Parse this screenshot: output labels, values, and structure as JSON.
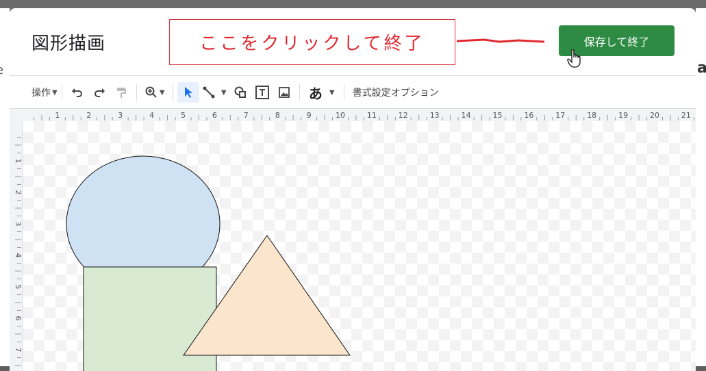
{
  "dialog": {
    "title": "図形描画",
    "save_label": "保存して終了"
  },
  "callout": {
    "text": "ここをクリックして終了",
    "color": "#e0282e"
  },
  "toolbar": {
    "actions_label": "操作",
    "format_options_label": "書式設定オプション",
    "text_style_glyph": "あ",
    "icons": [
      "undo-icon",
      "redo-icon",
      "paint-format-icon",
      "zoom-icon",
      "select-icon",
      "line-icon",
      "shape-icon",
      "textbox-icon",
      "image-icon",
      "text-style-icon"
    ]
  },
  "ruler": {
    "horizontal": [
      "1",
      "2",
      "3",
      "4",
      "5",
      "6",
      "7",
      "8",
      "9",
      "10",
      "11",
      "12",
      "13",
      "14",
      "15",
      "16",
      "17",
      "18",
      "19",
      "20",
      "21"
    ],
    "vertical": [
      "1",
      "2",
      "3",
      "4",
      "5",
      "6",
      "7"
    ]
  },
  "colors": {
    "save_button": "#2e8b44",
    "circle_fill": "#cfe2f3",
    "rect_fill": "#d9ead3",
    "triangle_fill": "#fce5cd"
  },
  "backdrop": {
    "right_glyph": "a",
    "left_glyph": "e"
  }
}
